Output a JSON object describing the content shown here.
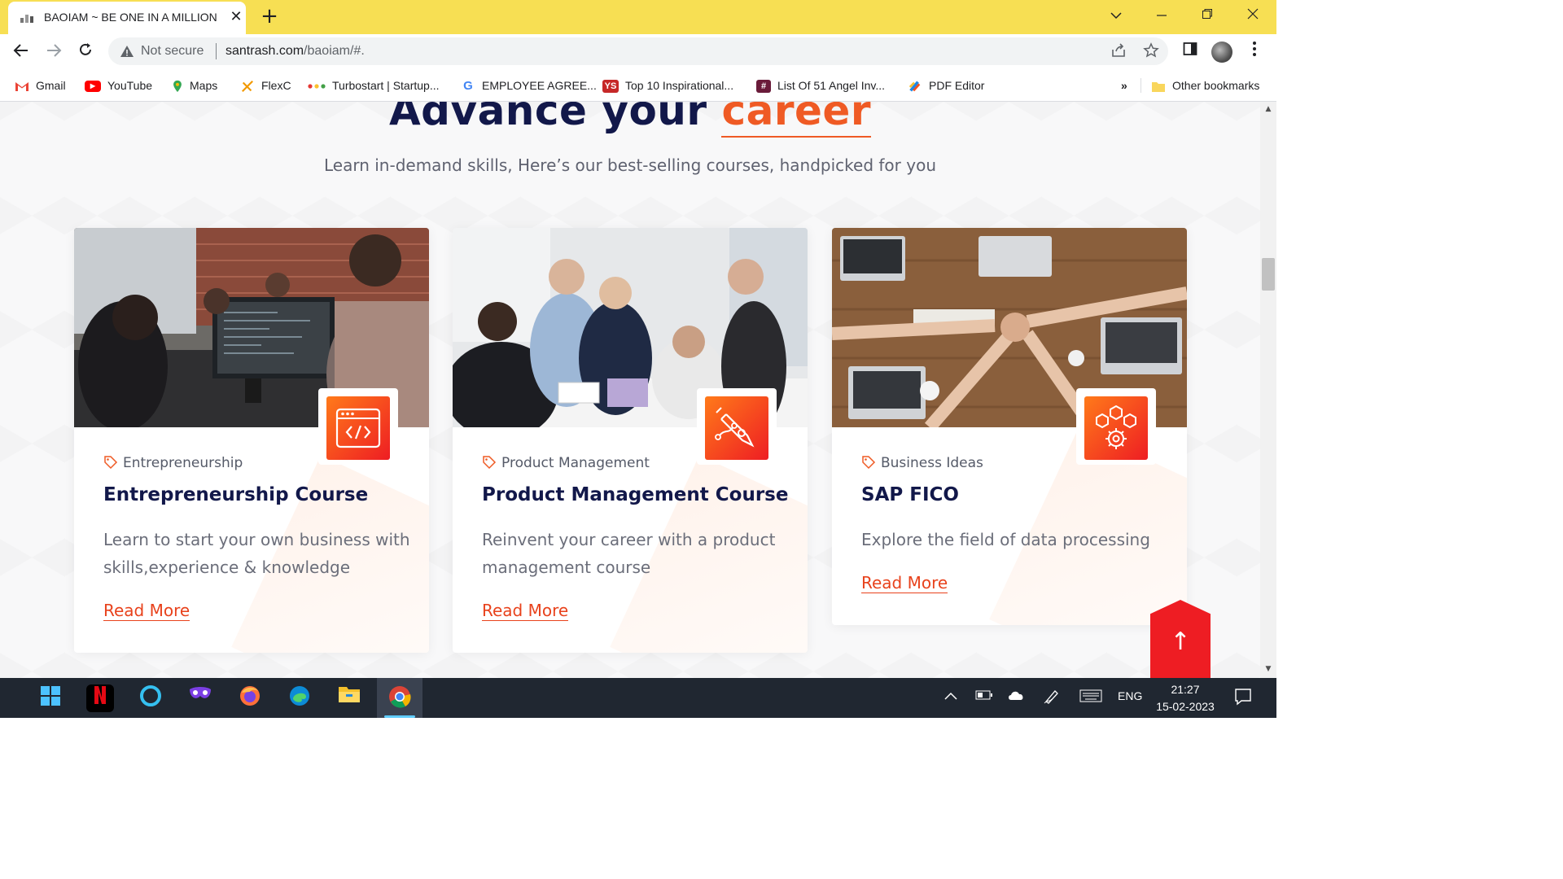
{
  "browser": {
    "tab_title": "BAOIAM ~ BE ONE IN A MILLION",
    "new_tab": "+",
    "security": "Not secure",
    "url_host": "santrash.com",
    "url_path": "/baoiam/#.",
    "bookmarks": [
      {
        "label": "Gmail",
        "icon": "gmail-icon",
        "color": "#ea4335"
      },
      {
        "label": "YouTube",
        "icon": "youtube-icon",
        "color": "#ff0000"
      },
      {
        "label": "Maps",
        "icon": "maps-icon",
        "color": "#34a853"
      },
      {
        "label": "FlexC",
        "icon": "flexc-icon",
        "color": "#f29900"
      },
      {
        "label": "Turbostart | Startup...",
        "icon": "turbostart-icon",
        "color": "#e53935"
      },
      {
        "label": "EMPLOYEE AGREE...",
        "icon": "google-icon",
        "color": "#4285f4"
      },
      {
        "label": "Top 10 Inspirational...",
        "icon": "yourstory-icon",
        "color": "#c62828"
      },
      {
        "label": "List Of 51 Angel Inv...",
        "icon": "inc42-icon",
        "color": "#6a1b3a"
      },
      {
        "label": "PDF Editor",
        "icon": "pdf-editor-icon",
        "color": "#1e88e5"
      }
    ],
    "overflow": "»",
    "other_bookmarks": "Other bookmarks"
  },
  "page": {
    "headline_main": "Advance your",
    "headline_accent": "career",
    "subtitle": "Learn in-demand skills, Here’s our best-selling courses, handpicked for you",
    "accent_color": "#ef5a24",
    "cards": [
      {
        "category": "Entrepreneurship",
        "title": "Entrepreneurship Course",
        "description": "Learn to start your own business with skills,experience & knowledge",
        "link": "Read More",
        "icon": "code-window-icon"
      },
      {
        "category": "Product Management",
        "title": "Product Management Course",
        "description": "Reinvent your career with a product management course",
        "link": "Read More",
        "icon": "pen-tool-icon"
      },
      {
        "category": "Business Ideas",
        "title": "SAP FICO",
        "description": "Explore the field of data processing",
        "link": "Read More",
        "icon": "cubes-gear-icon"
      }
    ],
    "scroll_top": "↑"
  },
  "taskbar": {
    "language": "ENG",
    "time": "21:27",
    "date": "15-02-2023"
  }
}
